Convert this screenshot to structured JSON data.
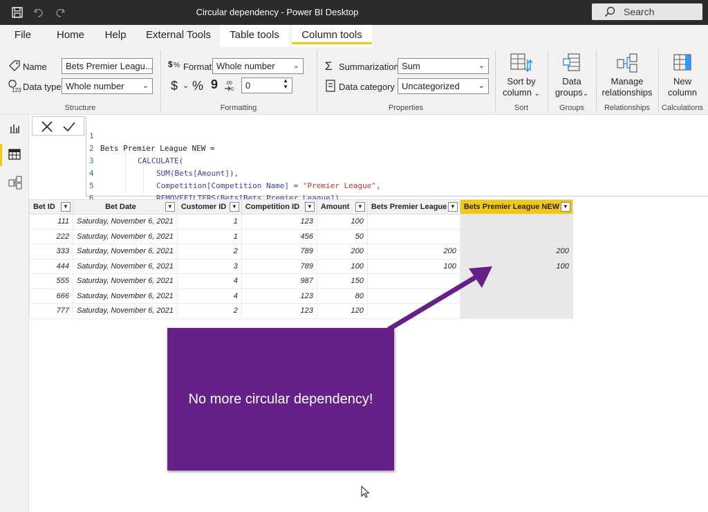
{
  "window": {
    "title": "Circular dependency - Power BI Desktop",
    "search_label": "Search"
  },
  "menu": {
    "tabs": [
      {
        "label": "File"
      },
      {
        "label": "Home"
      },
      {
        "label": "Help"
      },
      {
        "label": "External Tools"
      },
      {
        "label": "Table tools"
      },
      {
        "label": "Column tools"
      }
    ],
    "active_tab": "Column tools"
  },
  "ribbon": {
    "structure": {
      "name_label": "Name",
      "name_value": "Bets Premier Leagu...",
      "datatype_label": "Data type",
      "datatype_value": "Whole number",
      "group_label": "Structure"
    },
    "formatting": {
      "format_label": "Format",
      "format_value": "Whole number",
      "currency_symbol": "$",
      "percent_symbol": "%",
      "comma_symbol": "9",
      "decimals_value": "0",
      "group_label": "Formatting"
    },
    "properties": {
      "summarization_label": "Summarization",
      "summarization_value": "Sum",
      "category_label": "Data category",
      "category_value": "Uncategorized",
      "group_label": "Properties"
    },
    "sort": {
      "button_line1": "Sort by",
      "button_line2": "column",
      "group_label": "Sort"
    },
    "groups": {
      "button_line1": "Data",
      "button_line2": "groups",
      "group_label": "Groups"
    },
    "relationships": {
      "button_line1": "Manage",
      "button_line2": "relationships",
      "group_label": "Relationships"
    },
    "calculations": {
      "button_line1": "New",
      "button_line2": "column",
      "group_label": "Calculations"
    }
  },
  "formula": {
    "lines": [
      {
        "num": "1",
        "text": "Bets Premier League NEW ="
      },
      {
        "num": "2",
        "text": "CALCULATE("
      },
      {
        "num": "3",
        "text": "SUM(Bets[Amount]),"
      },
      {
        "num": "4",
        "text_a": "Competition[Competition Name] = ",
        "text_b": "\"Premier League\"",
        "text_c": ","
      },
      {
        "num": "5",
        "text": "REMOVEFILTERS(Bets[Bets Premier League])"
      },
      {
        "num": "6",
        "text": ")"
      }
    ]
  },
  "table": {
    "columns": [
      "Bet ID",
      "Bet Date",
      "Customer ID",
      "Competition ID",
      "Amount",
      "Bets Premier League",
      "Bets Premier League NEW"
    ],
    "rows": [
      [
        "111",
        "Saturday, November 6, 2021",
        "1",
        "123",
        "100",
        "",
        ""
      ],
      [
        "222",
        "Saturday, November 6, 2021",
        "1",
        "456",
        "50",
        "",
        ""
      ],
      [
        "333",
        "Saturday, November 6, 2021",
        "2",
        "789",
        "200",
        "200",
        "200"
      ],
      [
        "444",
        "Saturday, November 6, 2021",
        "3",
        "789",
        "100",
        "100",
        "100"
      ],
      [
        "555",
        "Saturday, November 6, 2021",
        "4",
        "987",
        "150",
        "",
        ""
      ],
      [
        "666",
        "Saturday, November 6, 2021",
        "4",
        "123",
        "80",
        "",
        ""
      ],
      [
        "777",
        "Saturday, November 6, 2021",
        "2",
        "123",
        "120",
        "",
        ""
      ]
    ]
  },
  "annotation": {
    "text": "No more circular dependency!",
    "color": "#652189"
  },
  "colors": {
    "accent": "#f2c811",
    "titlebar": "#2b2b2b",
    "ribbon": "#f3f2f1"
  }
}
